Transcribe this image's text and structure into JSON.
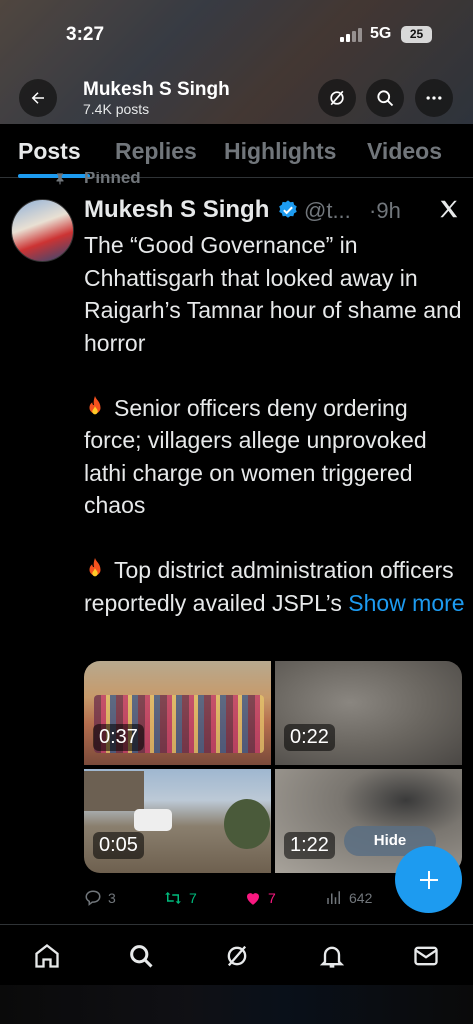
{
  "status": {
    "time": "3:27",
    "network": "5G",
    "battery": "25"
  },
  "header": {
    "name": "Mukesh S Singh",
    "posts": "7.4K posts"
  },
  "tabs": [
    "Posts",
    "Replies",
    "Highlights",
    "Videos"
  ],
  "pinned_label": "Pinned",
  "tweet": {
    "author": "Mukesh S Singh",
    "handle": "@t...",
    "separator": "·",
    "time": "9h",
    "line1": "The “Good Governance” in Chhattisgarh that looked away in Raigarh’s Tamnar hour of shame and horror",
    "line2": "Senior officers deny ordering force; villagers allege unprovoked lathi charge on women triggered chaos",
    "line3": "Top district administration officers reportedly availed JSPL’s",
    "show_more": "Show more"
  },
  "media": {
    "durations": [
      "0:37",
      "0:22",
      "0:05",
      "1:22"
    ]
  },
  "hide_label": "Hide",
  "engagement": {
    "replies": "3",
    "retweets": "7",
    "likes": "7",
    "views": "642"
  },
  "colors": {
    "accent": "#1d9bf0",
    "retweet": "#00ba7c",
    "like": "#f91880",
    "muted": "#71767b"
  }
}
